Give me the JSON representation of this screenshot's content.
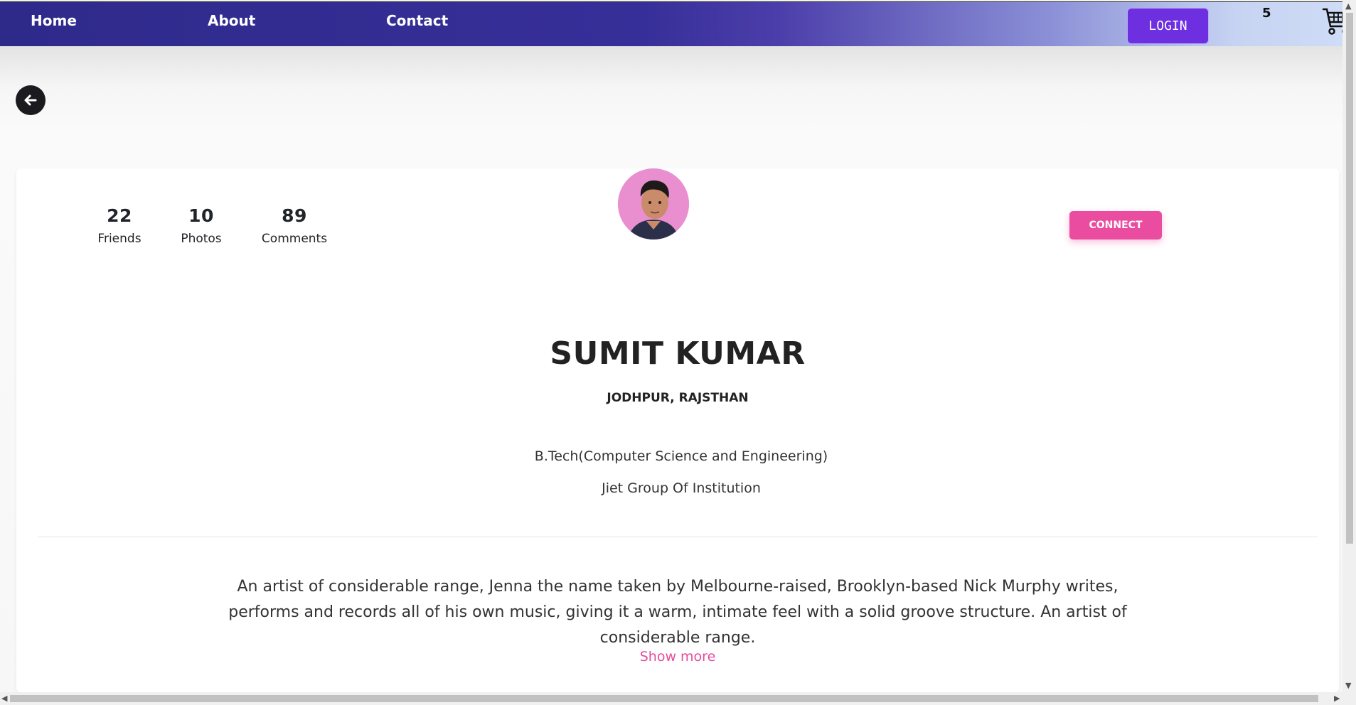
{
  "nav": {
    "links": [
      "Home",
      "About",
      "Contact"
    ],
    "login_label": "LOGIN",
    "cart_count": "5"
  },
  "profile": {
    "stats": [
      {
        "value": "22",
        "label": "Friends"
      },
      {
        "value": "10",
        "label": "Photos"
      },
      {
        "value": "89",
        "label": "Comments"
      }
    ],
    "connect_label": "CONNECT",
    "name": "SUMIT KUMAR",
    "location": "JODHPUR, RAJSTHAN",
    "degree": "B.Tech(Computer Science and Engineering)",
    "college": "Jiet Group Of Institution",
    "bio": "An artist of considerable range, Jenna the name taken by Melbourne-raised, Brooklyn-based Nick Murphy writes, performs and records all of his own music, giving it a warm, intimate feel with a solid groove structure. An artist of considerable range.",
    "show_more_label": "Show more"
  },
  "colors": {
    "nav_start": "#2e2a8a",
    "nav_end": "#cfdcf6",
    "login_bg": "#6d2fe0",
    "connect_bg": "#ea4c9f",
    "show_more": "#e64c9b",
    "avatar_bg": "#e98fd0"
  },
  "icons": {
    "back": "arrow-left-icon",
    "cart": "shopping-cart-icon"
  }
}
